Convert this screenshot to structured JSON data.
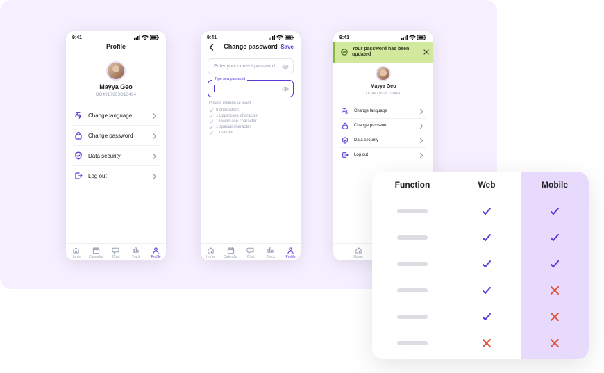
{
  "status_time": "9:41",
  "phone1": {
    "title": "Profile",
    "user_name": "Mayya Geo",
    "user_id": "OO4917663O13464",
    "menu": [
      {
        "icon": "language-icon",
        "label": "Change language"
      },
      {
        "icon": "lock-icon",
        "label": "Change password"
      },
      {
        "icon": "shield-icon",
        "label": "Data security"
      },
      {
        "icon": "logout-icon",
        "label": "Log out"
      }
    ]
  },
  "phone2": {
    "title": "Change password",
    "save": "Save",
    "current_placeholder": "Enter your current password",
    "new_label": "Type new password",
    "requirements_header": "Please include at least:",
    "requirements": [
      "8 characters",
      "1 uppercase character",
      "1 lowercase character",
      "1 special character",
      "1 number"
    ]
  },
  "phone3": {
    "banner": "Your password has been updated",
    "user_name": "Mayya Geo",
    "user_id": "OO4917663O13464",
    "menu": [
      {
        "icon": "language-icon",
        "label": "Change language"
      },
      {
        "icon": "lock-icon",
        "label": "Change password"
      },
      {
        "icon": "shield-icon",
        "label": "Data security"
      },
      {
        "icon": "logout-icon",
        "label": "Log out"
      }
    ]
  },
  "tabs": [
    {
      "label": "Home",
      "icon": "home-icon"
    },
    {
      "label": "Calendar",
      "icon": "calendar-icon"
    },
    {
      "label": "Chat",
      "icon": "chat-icon"
    },
    {
      "label": "Track",
      "icon": "track-icon"
    },
    {
      "label": "Profile",
      "icon": "profile-icon",
      "active": true
    }
  ],
  "compare": {
    "headers": {
      "func": "Function",
      "web": "Web",
      "mobile": "Mobile"
    },
    "rows": [
      {
        "web": "check",
        "mobile": "check"
      },
      {
        "web": "check",
        "mobile": "check"
      },
      {
        "web": "check",
        "mobile": "check"
      },
      {
        "web": "check",
        "mobile": "cross"
      },
      {
        "web": "check",
        "mobile": "cross"
      },
      {
        "web": "cross",
        "mobile": "cross"
      }
    ]
  }
}
